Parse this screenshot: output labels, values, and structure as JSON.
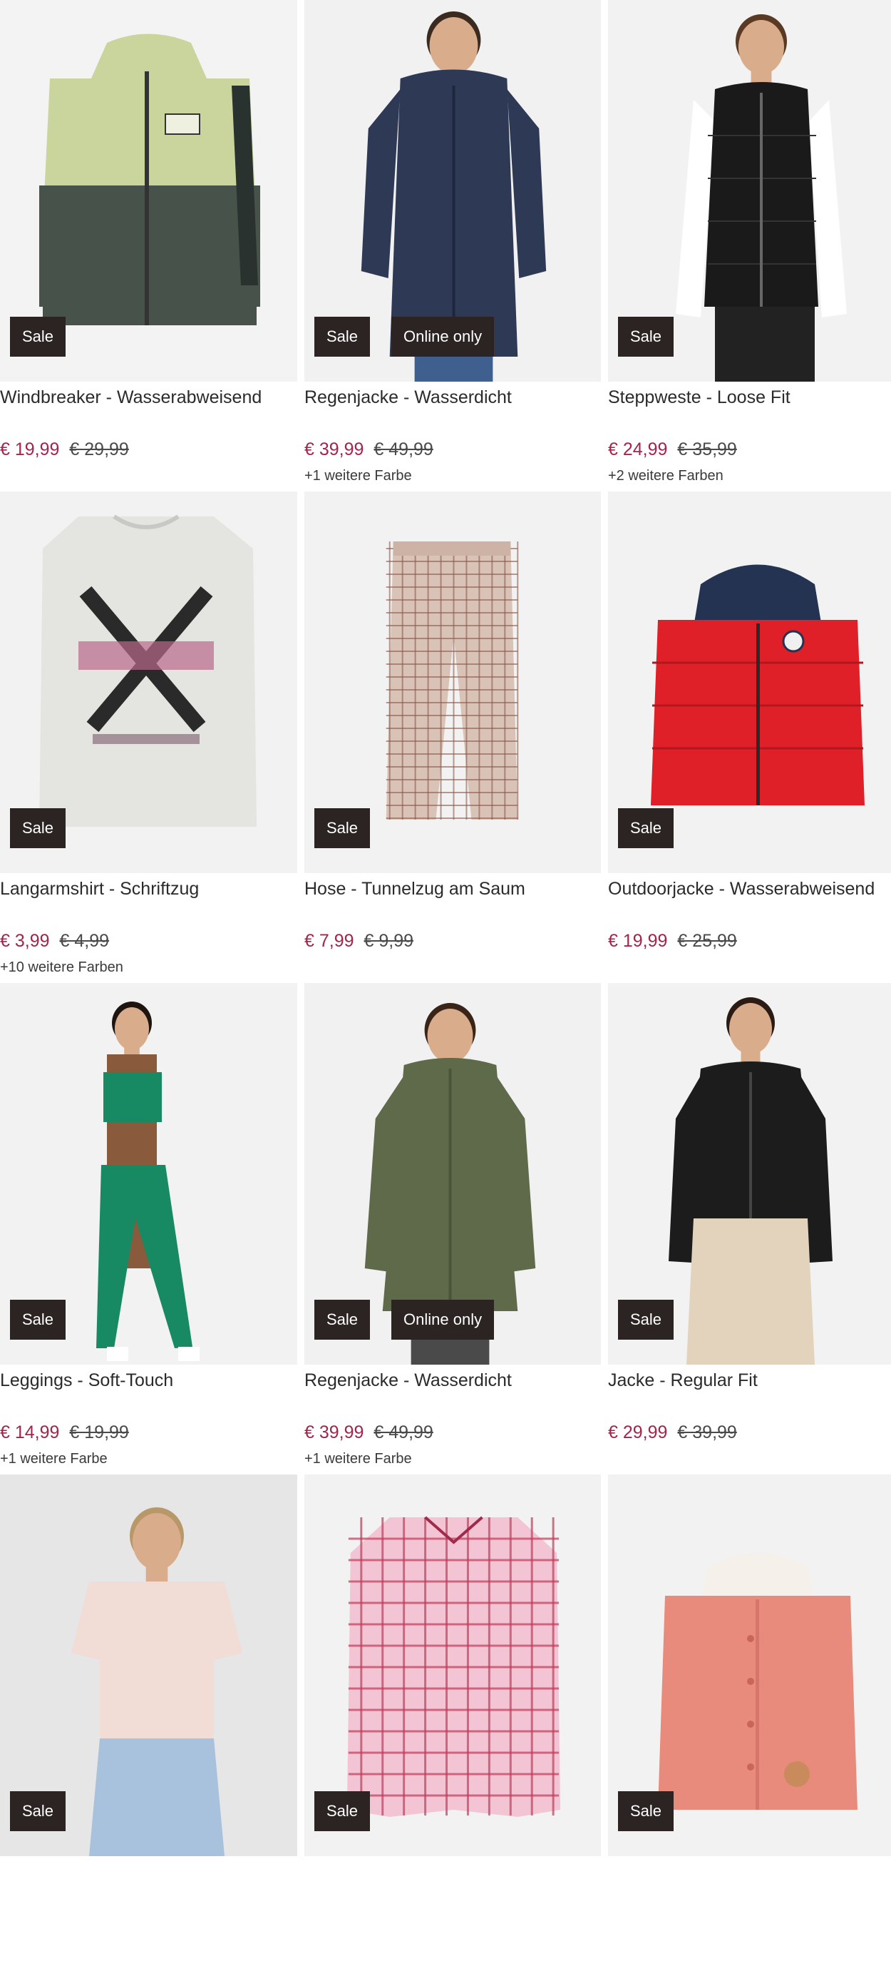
{
  "products": [
    {
      "title": "Windbreaker - Wasserabweisend",
      "price": "€ 19,99",
      "old_price": "€ 29,99",
      "colors": "",
      "badges": [
        "Sale"
      ],
      "image": "green-hooded-jacket",
      "palette": {
        "bg": "#f3f3f3",
        "main": "#c9d59c",
        "accent": "#47524a"
      }
    },
    {
      "title": "Regenjacke - Wasserdicht",
      "price": "€ 39,99",
      "old_price": "€ 49,99",
      "colors": "+1 weitere Farbe",
      "badges": [
        "Sale",
        "Online only"
      ],
      "image": "navy-rain-jacket-model",
      "palette": {
        "bg": "#f1f1f1",
        "main": "#2e3a55",
        "accent": "#3f5f8f"
      }
    },
    {
      "title": "Steppweste - Loose Fit",
      "price": "€ 24,99",
      "old_price": "€ 35,99",
      "colors": "+2 weitere Farben",
      "badges": [
        "Sale"
      ],
      "image": "black-puffer-vest-model",
      "palette": {
        "bg": "#f2f2f2",
        "main": "#1a1a1a",
        "accent": "#ffffff"
      }
    },
    {
      "title": "Langarmshirt - Schriftzug",
      "price": "€ 3,99",
      "old_price": "€ 4,99",
      "colors": "+10 weitere Farben",
      "badges": [
        "Sale"
      ],
      "image": "grey-longsleeve-print",
      "palette": {
        "bg": "#f2f2f2",
        "main": "#e4e4e0",
        "accent": "#2a2a2a"
      }
    },
    {
      "title": "Hose - Tunnelzug am Saum",
      "price": "€ 7,99",
      "old_price": "€ 9,99",
      "colors": "",
      "badges": [
        "Sale"
      ],
      "image": "checked-trousers",
      "palette": {
        "bg": "#f2f2f2",
        "main": "#d9c3b6",
        "accent": "#8a5a4a"
      }
    },
    {
      "title": "Outdoorjacke - Wasserabweisend",
      "price": "€ 19,99",
      "old_price": "€ 25,99",
      "colors": "",
      "badges": [
        "Sale"
      ],
      "image": "red-kids-puffer-jacket",
      "palette": {
        "bg": "#f2f2f2",
        "main": "#e02028",
        "accent": "#243352"
      }
    },
    {
      "title": "Leggings - Soft-Touch",
      "price": "€ 14,99",
      "old_price": "€ 19,99",
      "colors": "+1 weitere Farbe",
      "badges": [
        "Sale"
      ],
      "image": "green-sport-set-model",
      "palette": {
        "bg": "#f2f2f2",
        "main": "#178a63",
        "accent": "#8a5a3c"
      }
    },
    {
      "title": "Regenjacke - Wasserdicht",
      "price": "€ 39,99",
      "old_price": "€ 49,99",
      "colors": "+1 weitere Farbe",
      "badges": [
        "Sale",
        "Online only"
      ],
      "image": "olive-rain-coat-model",
      "palette": {
        "bg": "#f1f1f1",
        "main": "#5e6a49",
        "accent": "#4a4a4a"
      }
    },
    {
      "title": "Jacke - Regular Fit",
      "price": "€ 29,99",
      "old_price": "€ 39,99",
      "colors": "",
      "badges": [
        "Sale"
      ],
      "image": "black-short-jacket-model",
      "palette": {
        "bg": "#f2f2f2",
        "main": "#1c1c1c",
        "accent": "#e3d2bc"
      }
    },
    {
      "title": "",
      "price": "",
      "old_price": "",
      "colors": "",
      "badges": [
        "Sale"
      ],
      "image": "printed-tshirt-model",
      "palette": {
        "bg": "#e6e6e6",
        "main": "#f1dcd6",
        "accent": "#a8c1dc"
      }
    },
    {
      "title": "",
      "price": "",
      "old_price": "",
      "colors": "",
      "badges": [
        "Sale"
      ],
      "image": "pink-checked-shirt",
      "palette": {
        "bg": "#f2f2f2",
        "main": "#f3c5d4",
        "accent": "#c23a5a"
      }
    },
    {
      "title": "",
      "price": "",
      "old_price": "",
      "colors": "",
      "badges": [
        "Sale"
      ],
      "image": "pink-knit-baby-jacket",
      "palette": {
        "bg": "#f2f2f2",
        "main": "#e88a7c",
        "accent": "#f5f0ea"
      }
    }
  ]
}
